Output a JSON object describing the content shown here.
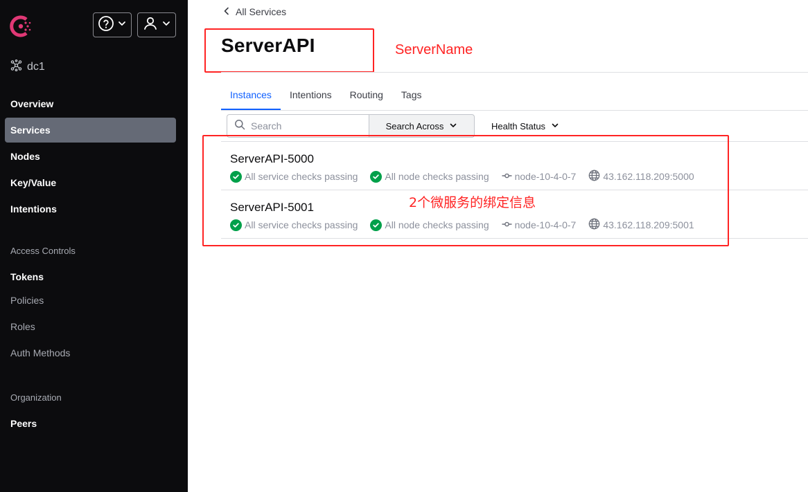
{
  "header": {
    "help_icon": "help-circle-icon",
    "user_icon": "user-icon",
    "datacenter": "dc1"
  },
  "sidebar": {
    "primary": [
      {
        "label": "Overview"
      },
      {
        "label": "Services",
        "active": true
      },
      {
        "label": "Nodes"
      },
      {
        "label": "Key/Value"
      },
      {
        "label": "Intentions"
      }
    ],
    "access_heading": "Access Controls",
    "access": [
      {
        "label": "Tokens"
      },
      {
        "label": "Policies"
      },
      {
        "label": "Roles"
      },
      {
        "label": "Auth Methods"
      }
    ],
    "org_heading": "Organization",
    "org": [
      {
        "label": "Peers"
      }
    ]
  },
  "main": {
    "back_label": "All Services",
    "title": "ServerAPI",
    "tabs": [
      {
        "label": "Instances",
        "active": true
      },
      {
        "label": "Intentions"
      },
      {
        "label": "Routing"
      },
      {
        "label": "Tags"
      }
    ],
    "search": {
      "placeholder": "Search",
      "value": ""
    },
    "search_across_label": "Search Across",
    "health_status_label": "Health Status",
    "instances": [
      {
        "name": "ServerAPI-5000",
        "service_checks": "All service checks passing",
        "node_checks": "All node checks passing",
        "node": "node-10-4-0-7",
        "address": "43.162.118.209:5000"
      },
      {
        "name": "ServerAPI-5001",
        "service_checks": "All service checks passing",
        "node_checks": "All node checks passing",
        "node": "node-10-4-0-7",
        "address": "43.162.118.209:5001"
      }
    ]
  },
  "annotations": {
    "server_name": "ServerName",
    "instances_note": "2个微服务的绑定信息",
    "color": "#ff2323"
  },
  "colors": {
    "sidebar_bg": "#0c0c0e",
    "active_nav": "#656a76",
    "accent": "#1060ff",
    "passing": "#00a04a"
  }
}
